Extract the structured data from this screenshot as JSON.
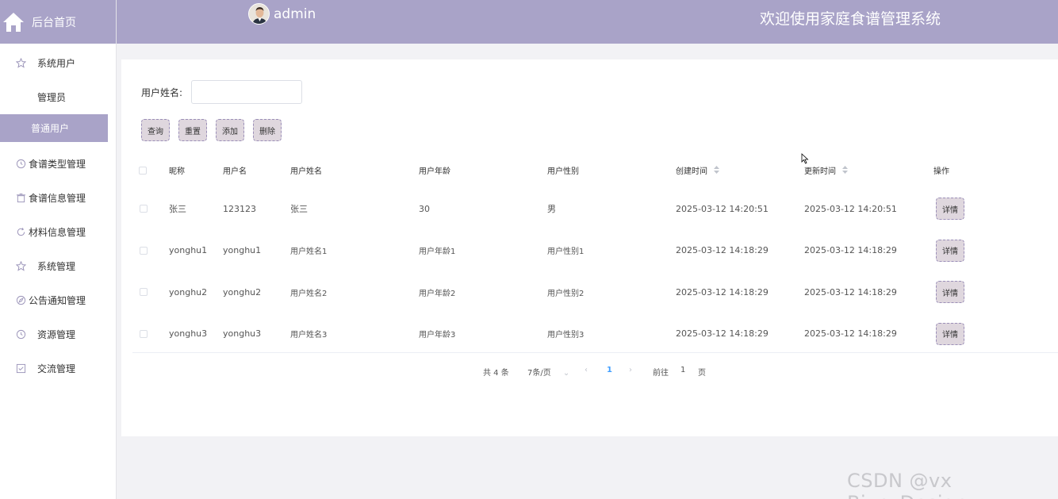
{
  "sidebar": {
    "brand_label": "后台首页",
    "items": [
      {
        "label": "系统用户",
        "icon": "star-icon"
      },
      {
        "label": "管理员"
      },
      {
        "label": "普通用户"
      },
      {
        "label": "食谱类型管理",
        "icon": "clock-icon"
      },
      {
        "label": "食谱信息管理",
        "icon": "trash-icon"
      },
      {
        "label": "材料信息管理",
        "icon": "refresh-icon"
      },
      {
        "label": "系统管理",
        "icon": "star-icon"
      },
      {
        "label": "公告通知管理",
        "icon": "compass-icon"
      },
      {
        "label": "资源管理",
        "icon": "clock-icon"
      },
      {
        "label": "交流管理",
        "icon": "checkbox-icon"
      }
    ]
  },
  "header": {
    "admin_name": "admin",
    "welcome": "欢迎使用家庭食谱管理系统",
    "accent_color": "#a9a3c8"
  },
  "search": {
    "label": "用户姓名:",
    "value": "",
    "placeholder": ""
  },
  "actions": {
    "query": "查询",
    "reset": "重置",
    "add": "添加",
    "delete": "删除"
  },
  "table": {
    "headers": {
      "nickname": "昵称",
      "username": "用户名",
      "realname": "用户姓名",
      "age": "用户年龄",
      "gender": "用户性别",
      "created": "创建时间",
      "updated": "更新时间",
      "ops": "操作"
    },
    "detail_label": "详情",
    "rows": [
      {
        "nickname": "张三",
        "username": "123123",
        "realname": "张三",
        "age": "30",
        "gender": "男",
        "created": "2025-03-12 14:20:51",
        "updated": "2025-03-12 14:20:51"
      },
      {
        "nickname": "yonghu1",
        "username": "yonghu1",
        "realname": "用户姓名1",
        "age": "用户年龄1",
        "gender": "用户性别1",
        "created": "2025-03-12 14:18:29",
        "updated": "2025-03-12 14:18:29"
      },
      {
        "nickname": "yonghu2",
        "username": "yonghu2",
        "realname": "用户姓名2",
        "age": "用户年龄2",
        "gender": "用户性别2",
        "created": "2025-03-12 14:18:29",
        "updated": "2025-03-12 14:18:29"
      },
      {
        "nickname": "yonghu3",
        "username": "yonghu3",
        "realname": "用户姓名3",
        "age": "用户年龄3",
        "gender": "用户性别3",
        "created": "2025-03-12 14:18:29",
        "updated": "2025-03-12 14:18:29"
      }
    ]
  },
  "pagination": {
    "total": "共 4 条",
    "page_size": "7条/页",
    "current": "1",
    "goto_label": "前往",
    "goto_value": "1",
    "page_suffix": "页"
  },
  "watermark": "CSDN @vx Biye_Design"
}
